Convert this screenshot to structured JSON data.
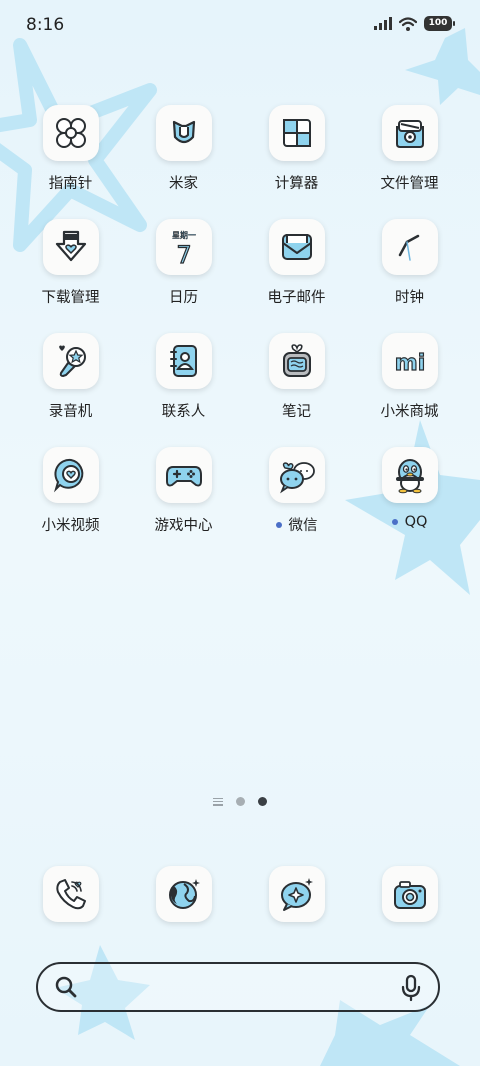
{
  "status_bar": {
    "time": "8:16",
    "battery": "100"
  },
  "apps": [
    {
      "label": "指南针",
      "icon": "compass-icon",
      "dot": false
    },
    {
      "label": "米家",
      "icon": "mijia-icon",
      "dot": false
    },
    {
      "label": "计算器",
      "icon": "calculator-icon",
      "dot": false
    },
    {
      "label": "文件管理",
      "icon": "file-manager-icon",
      "dot": false
    },
    {
      "label": "下载管理",
      "icon": "download-icon",
      "dot": false
    },
    {
      "label": "日历",
      "icon": "calendar-icon",
      "dot": false,
      "calendar_weekday": "星期一",
      "calendar_day": "7"
    },
    {
      "label": "电子邮件",
      "icon": "email-icon",
      "dot": false
    },
    {
      "label": "时钟",
      "icon": "clock-icon",
      "dot": false
    },
    {
      "label": "录音机",
      "icon": "recorder-icon",
      "dot": false
    },
    {
      "label": "联系人",
      "icon": "contacts-icon",
      "dot": false
    },
    {
      "label": "笔记",
      "icon": "notes-icon",
      "dot": false
    },
    {
      "label": "小米商城",
      "icon": "mi-store-icon",
      "dot": false,
      "logo_text": "mi"
    },
    {
      "label": "小米视频",
      "icon": "video-icon",
      "dot": false
    },
    {
      "label": "游戏中心",
      "icon": "gamepad-icon",
      "dot": false
    },
    {
      "label": "微信",
      "icon": "wechat-icon",
      "dot": true
    },
    {
      "label": "QQ",
      "icon": "qq-penguin-icon",
      "dot": true
    }
  ],
  "dock": [
    {
      "icon": "phone-icon"
    },
    {
      "icon": "browser-globe-icon"
    },
    {
      "icon": "messages-icon"
    },
    {
      "icon": "camera-icon"
    }
  ],
  "page_indicator": {
    "pages": 2,
    "active_page": 2
  },
  "search": {
    "placeholder": ""
  },
  "colors": {
    "accent_blue": "#8fd3ee",
    "icon_stroke": "#2a2f33",
    "background": "#e9f6fb",
    "notification_dot": "#4a6fc7"
  }
}
